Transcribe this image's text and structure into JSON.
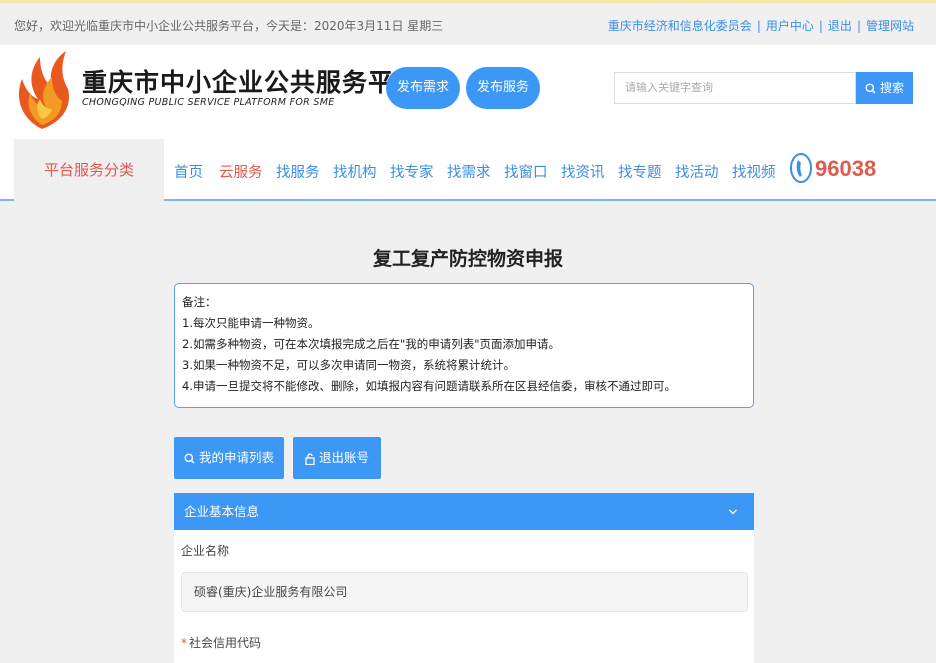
{
  "topbar": {
    "welcome": "您好，欢迎光临重庆市中小企业公共服务平台，今天是：2020年3月11日 星期三",
    "links": [
      "重庆市经济和信息化委员会",
      "用户中心",
      "退出",
      "管理网站"
    ]
  },
  "header": {
    "logo_title": "重庆市中小企业公共服务平台",
    "logo_subtitle": "CHONGQING PUBLIC SERVICE PLATFORM FOR SME",
    "publish_demand": "发布需求",
    "publish_service": "发布服务",
    "search_placeholder": "请输入关键字查询",
    "search_button": "搜索"
  },
  "nav": {
    "category": "平台服务分类",
    "items": [
      "首页",
      "云服务",
      "找服务",
      "找机构",
      "找专家",
      "找需求",
      "找窗口",
      "找资讯",
      "找专题",
      "找活动",
      "找视频"
    ],
    "active_index": 1,
    "hotline": "96038"
  },
  "main": {
    "title": "复工复产防控物资申报",
    "notes": [
      "备注：",
      "1.每次只能申请一种物资。",
      "2.如需多种物资，可在本次填报完成之后在\"我的申请列表\"页面添加申请。",
      "3.如果一种物资不足，可以多次申请同一物资，系统将累计统计。",
      "4.申请一旦提交将不能修改、删除，如填报内容有问题请联系所在区县经信委，审核不通过即可。"
    ],
    "my_list_button": "我的申请列表",
    "logout_button": "退出账号",
    "section_title": "企业基本信息",
    "company_name_label": "企业名称",
    "company_name_value": "硕睿(重庆)企业服务有限公司",
    "credit_code_label": "社会信用代码",
    "required_mark": "*"
  },
  "colors": {
    "accent": "#3d97f5",
    "active_red": "#e05a4e",
    "link_blue": "#3a8ee6"
  }
}
